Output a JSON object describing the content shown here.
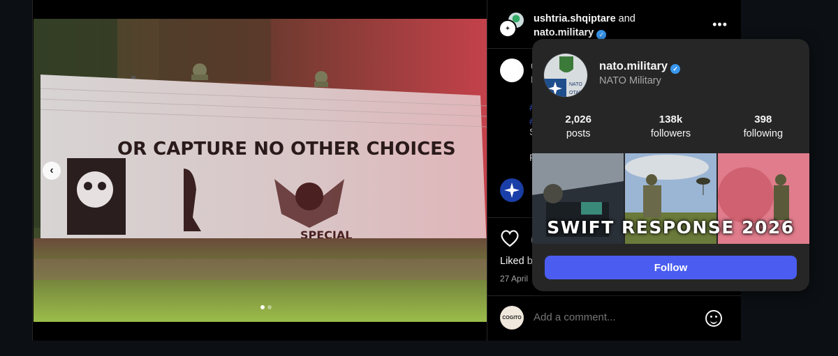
{
  "post": {
    "authors": {
      "first": "ushtria.shqiptare",
      "joiner": "and",
      "second": "nato.military"
    },
    "more_icon": "more-horizontal-icon",
    "caption": {
      "author_partial": "u",
      "text_partial": "K",
      "hashtag_1": "#",
      "hashtag_2": "#",
      "line_3": "S",
      "line_4": "F"
    },
    "photo_text": {
      "wall_slogan": "OR CAPTURE NO OTHER CHOICES",
      "wall_lower": "SPECIAL"
    },
    "carousel": {
      "prev_icon": "chevron-left-icon",
      "dot_count": 2,
      "active_dot": 0
    },
    "liked_by": "Liked b",
    "date": "27 April",
    "comment": {
      "avatar_text": "COGITO",
      "placeholder": "Add a comment...",
      "emoji_icon": "emoji-icon"
    }
  },
  "hover_card": {
    "username": "nato.military",
    "verified_icon": "verified-badge-icon",
    "full_name": "NATO Military",
    "avatar_text_1": "NATO",
    "avatar_text_2": "OTAN",
    "stats": [
      {
        "value": "2,026",
        "label": "posts"
      },
      {
        "value": "138k",
        "label": "followers"
      },
      {
        "value": "398",
        "label": "following"
      }
    ],
    "banner": "SWIFT RESPONSE 2026",
    "follow_label": "Follow"
  },
  "colors": {
    "background": "#0c1014",
    "card": "#262626",
    "follow_button": "#4a5df0",
    "verified": "#3897f0",
    "muted_text": "#a8a8a8"
  }
}
